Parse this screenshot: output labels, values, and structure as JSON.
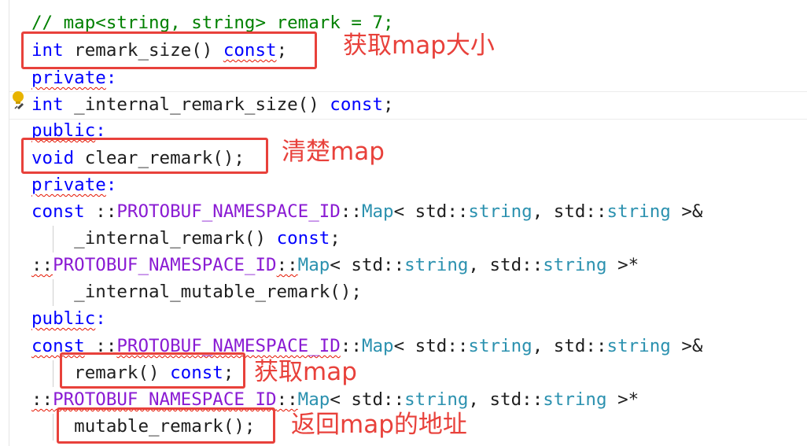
{
  "editor": {
    "lines": [
      {
        "parts": [
          {
            "t": "// map<string, string> remark = 7;",
            "c": "cm"
          }
        ]
      },
      {
        "parts": [
          {
            "t": "int",
            "c": "kw"
          },
          {
            "t": " remark_size() ",
            "c": "id"
          },
          {
            "t": "const",
            "c": "kw squig"
          },
          {
            "t": ";",
            "c": "id"
          }
        ]
      },
      {
        "parts": [
          {
            "t": "private",
            "c": "kw squig"
          },
          {
            "t": ":",
            "c": "kw"
          }
        ]
      },
      {
        "parts": [
          {
            "t": "int",
            "c": "kw"
          },
          {
            "t": " _internal_remark_size() ",
            "c": "id"
          },
          {
            "t": "const",
            "c": "kw"
          },
          {
            "t": ";",
            "c": "id"
          }
        ]
      },
      {
        "parts": [
          {
            "t": "public",
            "c": "kw squig"
          },
          {
            "t": ":",
            "c": "kw"
          }
        ]
      },
      {
        "parts": [
          {
            "t": "void",
            "c": "kw"
          },
          {
            "t": " clear_remark();",
            "c": "id"
          }
        ]
      },
      {
        "parts": [
          {
            "t": "private",
            "c": "kw squig"
          },
          {
            "t": ":",
            "c": "kw"
          }
        ]
      },
      {
        "parts": [
          {
            "t": "const",
            "c": "kw"
          },
          {
            "t": " ::",
            "c": "id"
          },
          {
            "t": "PROTOBUF_NAMESPACE_ID",
            "c": "ns"
          },
          {
            "t": "::",
            "c": "id"
          },
          {
            "t": "Map",
            "c": "ty"
          },
          {
            "t": "< std::",
            "c": "id"
          },
          {
            "t": "string",
            "c": "ty"
          },
          {
            "t": ", std::",
            "c": "id"
          },
          {
            "t": "string",
            "c": "ty"
          },
          {
            "t": " >&",
            "c": "id"
          }
        ]
      },
      {
        "parts": [
          {
            "t": "    _internal_remark() ",
            "c": "id"
          },
          {
            "t": "const",
            "c": "kw"
          },
          {
            "t": ";",
            "c": "id"
          }
        ]
      },
      {
        "parts": [
          {
            "t": "::",
            "c": "id squig"
          },
          {
            "t": "PROTOBUF_NAMESPACE_ID",
            "c": "ns"
          },
          {
            "t": "::",
            "c": "id squig"
          },
          {
            "t": "Map",
            "c": "ty"
          },
          {
            "t": "< std::",
            "c": "id"
          },
          {
            "t": "string",
            "c": "ty"
          },
          {
            "t": ", std::",
            "c": "id"
          },
          {
            "t": "string",
            "c": "ty"
          },
          {
            "t": " >*",
            "c": "id"
          }
        ]
      },
      {
        "parts": [
          {
            "t": "    _internal_mutable_remark();",
            "c": "id"
          }
        ]
      },
      {
        "parts": [
          {
            "t": "public",
            "c": "kw squig"
          },
          {
            "t": ":",
            "c": "kw"
          }
        ]
      },
      {
        "parts": [
          {
            "t": "const",
            "c": "kw squig"
          },
          {
            "t": " ::",
            "c": "id"
          },
          {
            "t": "PROTOBUF_NAMESPACE_ID",
            "c": "ns squig"
          },
          {
            "t": "::",
            "c": "id"
          },
          {
            "t": "Map",
            "c": "ty"
          },
          {
            "t": "< std::",
            "c": "id"
          },
          {
            "t": "string",
            "c": "ty"
          },
          {
            "t": ", std::",
            "c": "id"
          },
          {
            "t": "string",
            "c": "ty"
          },
          {
            "t": " >&",
            "c": "id"
          }
        ]
      },
      {
        "parts": [
          {
            "t": "    remark() ",
            "c": "id"
          },
          {
            "t": "const",
            "c": "kw"
          },
          {
            "t": ";",
            "c": "id"
          }
        ]
      },
      {
        "parts": [
          {
            "t": "::",
            "c": "id squig"
          },
          {
            "t": "PROTOBUF_NAMESPACE_ID",
            "c": "ns squig"
          },
          {
            "t": "::",
            "c": "id squig"
          },
          {
            "t": "Map",
            "c": "ty"
          },
          {
            "t": "< std::",
            "c": "id"
          },
          {
            "t": "string",
            "c": "ty"
          },
          {
            "t": ", std::",
            "c": "id"
          },
          {
            "t": "string",
            "c": "ty"
          },
          {
            "t": " >*",
            "c": "id"
          }
        ]
      },
      {
        "parts": [
          {
            "t": "    mutable_remark();",
            "c": "id"
          }
        ]
      }
    ]
  },
  "annotations": {
    "get_map_size": "获取map大小",
    "clear_map": "清楚map",
    "get_map": "获取map",
    "return_map_address": "返回map的地址"
  },
  "colors": {
    "annotation_red": "#e8413b",
    "keyword": "#0000ff",
    "namespace_macro": "#8a1bd3",
    "type": "#2b91af",
    "comment": "#008000"
  },
  "icons": {
    "lightbulb": "lightbulb-icon"
  }
}
